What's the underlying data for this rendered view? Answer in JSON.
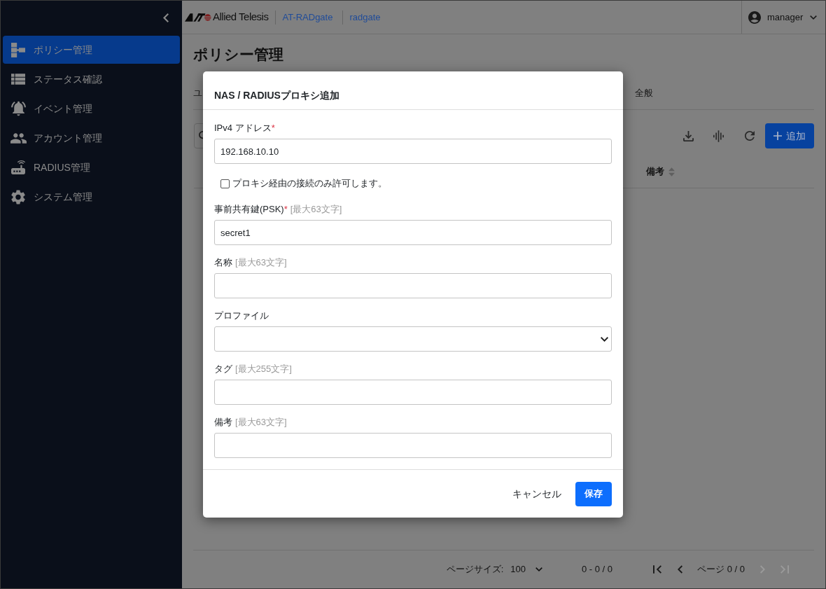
{
  "sidebar": {
    "items": [
      {
        "label": "ポリシー管理",
        "selected": true
      },
      {
        "label": "ステータス確認",
        "selected": false
      },
      {
        "label": "イベント管理",
        "selected": false
      },
      {
        "label": "アカウント管理",
        "selected": false
      },
      {
        "label": "RADIUS管理",
        "selected": false
      },
      {
        "label": "システム管理",
        "selected": false
      }
    ]
  },
  "header": {
    "brand": "Allied Telesis",
    "links": [
      "AT-RADgate",
      "radgate"
    ],
    "user": "manager"
  },
  "page": {
    "title": "ポリシー管理",
    "tabs": [
      {
        "label": "ユ",
        "selected": false
      },
      {
        "label": "全般",
        "selected": false
      }
    ],
    "toolbar": {
      "add_button": "追加"
    },
    "table": {
      "columns": [
        "備考"
      ]
    },
    "pagination": {
      "page_size_label": "ページサイズ:",
      "page_size": "100",
      "range": "0 - 0 / 0",
      "page": "ページ 0 / 0",
      "buttons": {
        "first": {
          "disabled": false
        },
        "previous": {
          "disabled": false
        },
        "next": {
          "disabled": true
        },
        "last": {
          "disabled": true
        }
      }
    }
  },
  "dialog": {
    "title": "NAS / RADIUSプロキシ追加",
    "fields": [
      {
        "kind": "text",
        "label": "IPv4 アドレス",
        "required_mark": "*",
        "value": "192.168.10.10"
      },
      {
        "kind": "checkbox",
        "label": "プロキシ経由の接続のみ許可します。",
        "checked": false
      },
      {
        "kind": "text",
        "label": "事前共有鍵(PSK)",
        "required_mark": "*",
        "hint": "[最大63文字]",
        "value": "secret1"
      },
      {
        "kind": "text",
        "label": "名称",
        "hint": "[最大63文字]"
      },
      {
        "kind": "select",
        "label": "プロファイル"
      },
      {
        "kind": "text",
        "label": "タグ",
        "hint": "[最大255文字]"
      },
      {
        "kind": "text",
        "label": "備考",
        "hint": "[最大63文字]"
      }
    ],
    "buttons": {
      "cancel": "キャンセル",
      "save": "保存"
    }
  }
}
